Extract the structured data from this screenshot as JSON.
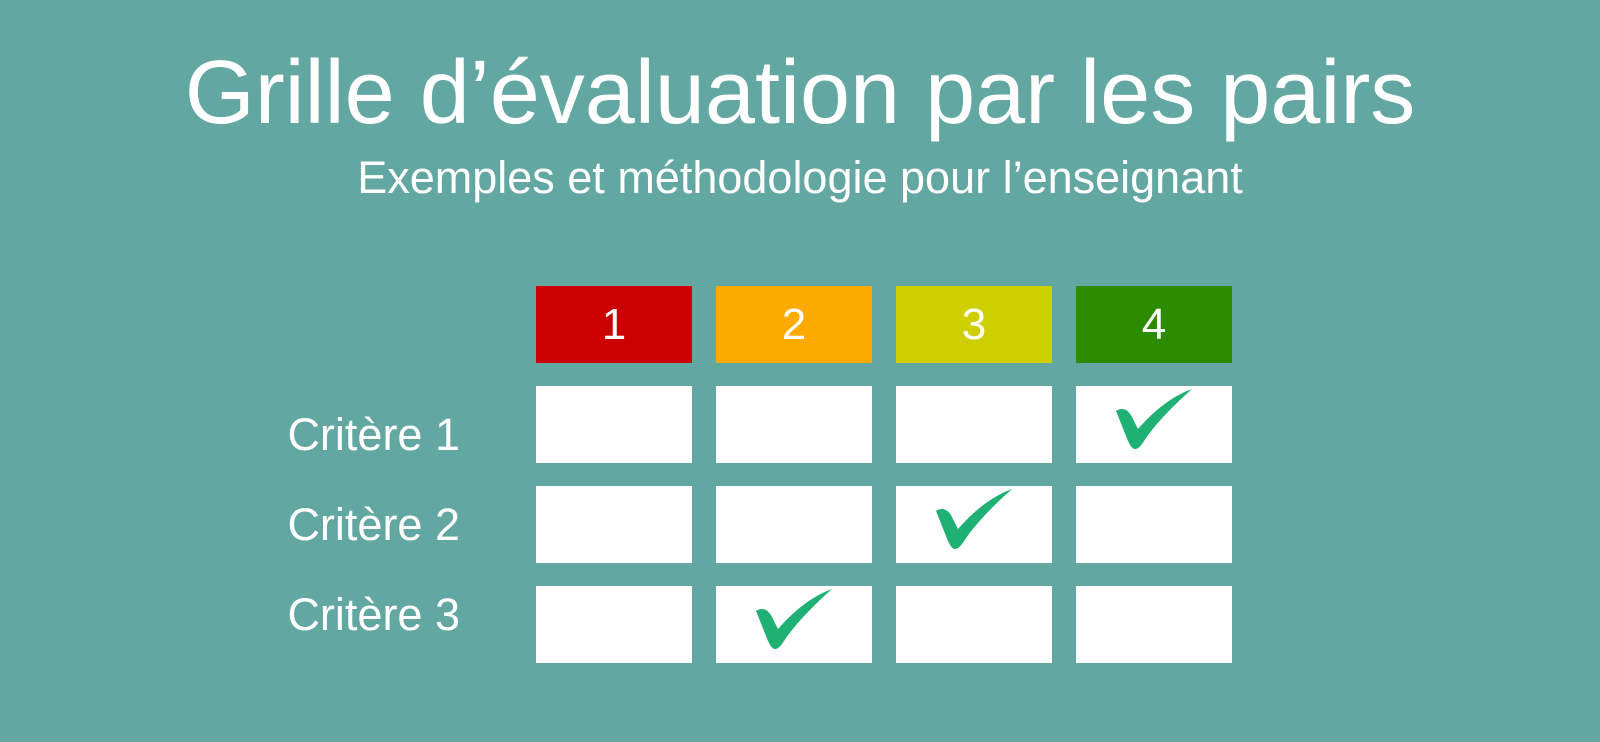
{
  "colors": {
    "background": "#62a7a2",
    "check": "#1fb074",
    "cell": "#ffffff",
    "text": "#ffffff"
  },
  "header": {
    "title": "Grille d’évaluation par les pairs",
    "subtitle": "Exemples et méthodologie pour l’enseignant"
  },
  "grid": {
    "levels": [
      {
        "label": "1",
        "color": "#cc0000"
      },
      {
        "label": "2",
        "color": "#ffaa00"
      },
      {
        "label": "3",
        "color": "#cfcf00"
      },
      {
        "label": "4",
        "color": "#2d8b00"
      }
    ],
    "criteria": [
      {
        "label": "Critère 1",
        "checked_level": 4
      },
      {
        "label": "Critère 2",
        "checked_level": 3
      },
      {
        "label": "Critère 3",
        "checked_level": 2
      }
    ],
    "check_icon": "checkmark-icon"
  }
}
